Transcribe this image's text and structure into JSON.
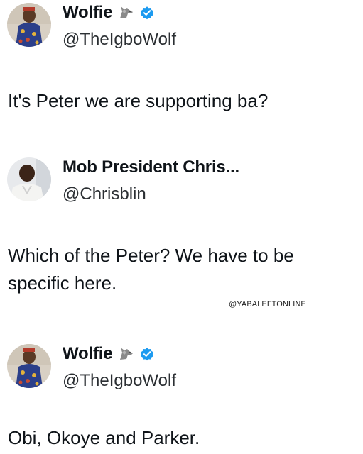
{
  "tweets": [
    {
      "display_name": "Wolfie",
      "handle": "@TheIgboWolf",
      "emoji_icon": "wolf-emoji-icon",
      "verified": true,
      "text": "It's Peter we are supporting ba?"
    },
    {
      "display_name": "Mob President Chris...",
      "handle": "@Chrisblin",
      "verified": false,
      "text_lines": [
        "Which of the Peter? We have to be",
        "specific here."
      ]
    },
    {
      "display_name": "Wolfie",
      "handle": "@TheIgboWolf",
      "emoji_icon": "wolf-emoji-icon",
      "verified": true,
      "text": "Obi, Okoye and Parker."
    }
  ],
  "watermark": "@YABALEFTONLINE",
  "colors": {
    "verified_badge": "#1d9bf0",
    "text": "#0f1419",
    "background": "#ffffff"
  }
}
